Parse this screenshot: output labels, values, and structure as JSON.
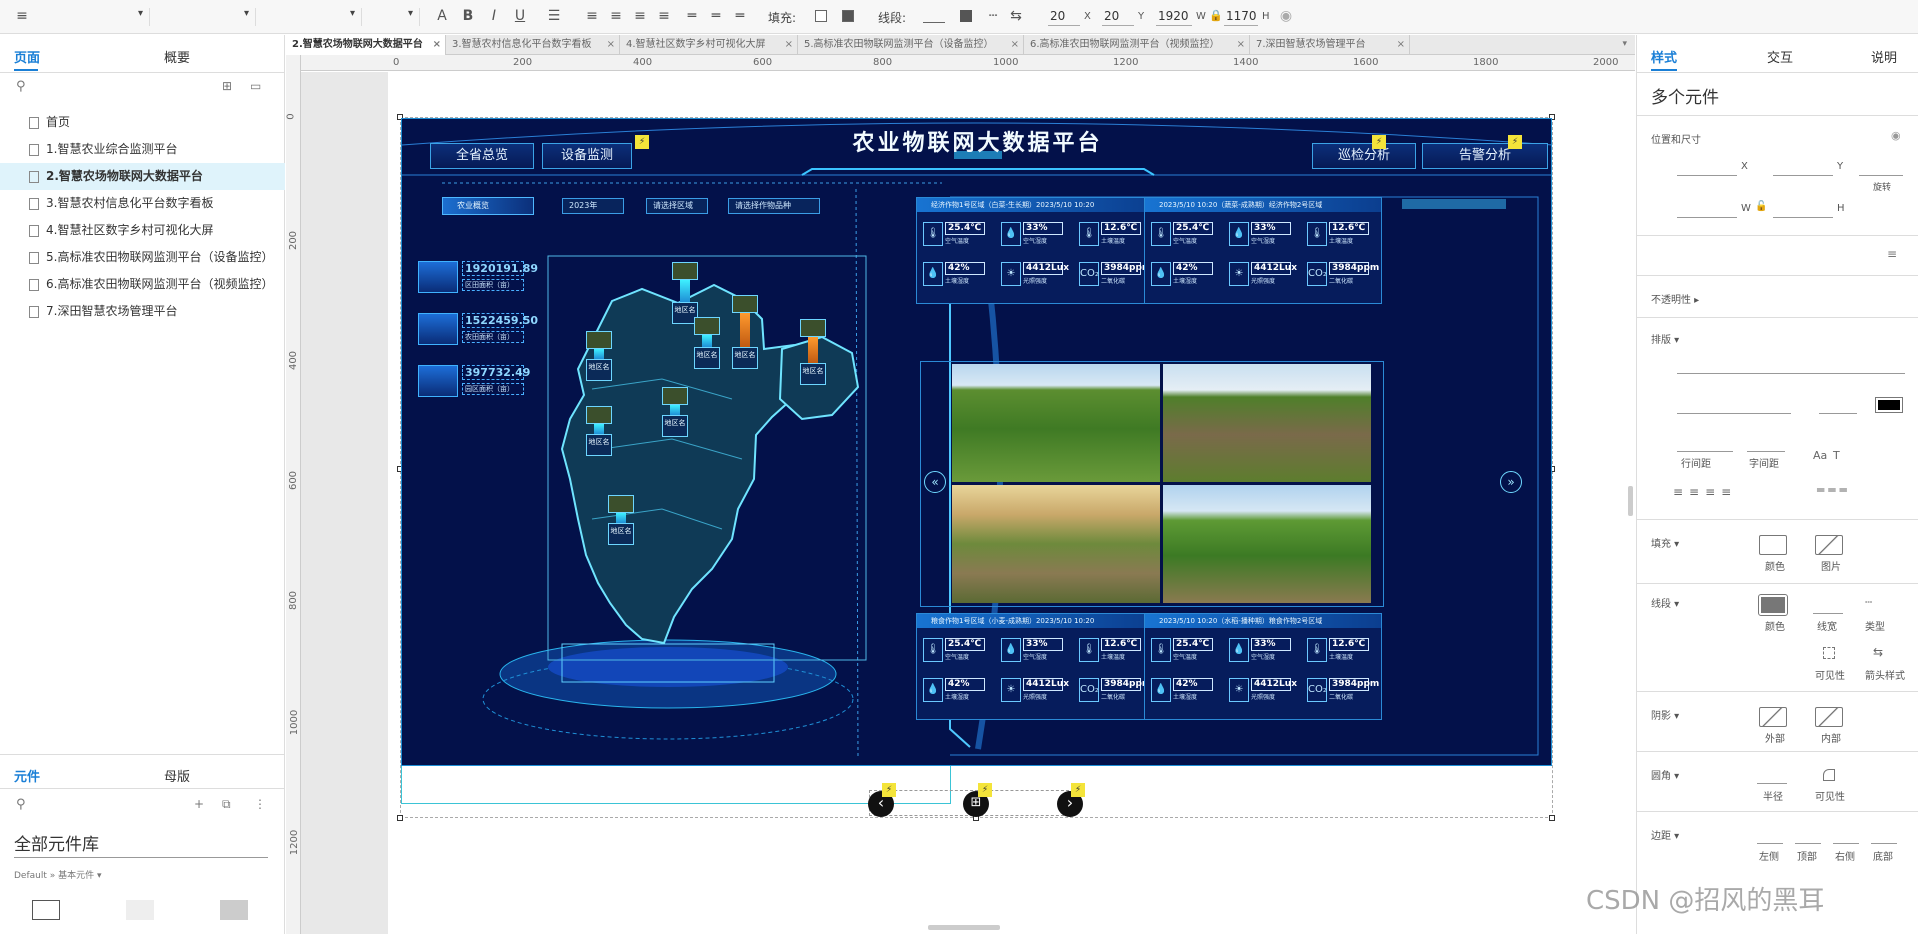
{
  "toolbar": {
    "fill_label": "填充:",
    "stroke_label": "线段:",
    "x": "20",
    "x_unit": "X",
    "y": "20",
    "y_unit": "Y",
    "w": "1920",
    "w_unit": "W",
    "h": "1170",
    "h_unit": "H"
  },
  "left": {
    "tab_pages": "页面",
    "tab_outline": "概要",
    "pages": [
      "首页",
      "1.智慧农业综合监测平台",
      "2.智慧农场物联网大数据平台",
      "3.智慧农村信息化平台数字看板",
      "4.智慧社区数字乡村可视化大屏",
      "5.高标准农田物联网监测平台（设备监控）",
      "6.高标准农田物联网监测平台（视频监控）",
      "7.深田智慧农场管理平台"
    ],
    "tab_widgets": "元件",
    "tab_masters": "母版",
    "library": "全部元件库",
    "library_sub": "Default » 基本元件 ▾"
  },
  "tabs": [
    "2.智慧农场物联网大数据平台",
    "3.智慧农村信息化平台数字看板",
    "4.智慧社区数字乡村可视化大屏",
    "5.高标准农田物联网监测平台（设备监控）",
    "6.高标准农田物联网监测平台（视频监控）",
    "7.深田智慧农场管理平台"
  ],
  "ruler_h": [
    "0",
    "200",
    "400",
    "600",
    "800",
    "1000",
    "1200",
    "1400",
    "1600",
    "1800",
    "2000"
  ],
  "ruler_v": [
    "0",
    "200",
    "400",
    "600",
    "800",
    "1000",
    "1200"
  ],
  "dashboard": {
    "title": "农业物联网大数据平台",
    "nav": [
      "全省总览",
      "设备监测",
      "巡检分析",
      "告警分析"
    ],
    "section_label": "农业概览",
    "selects": [
      "2023年",
      "请选择区域",
      "请选择作物品种"
    ],
    "stats": [
      {
        "value": "1920191.89",
        "label": "区田面积（亩）"
      },
      {
        "value": "1522459.50",
        "label": "农田面积（亩）"
      },
      {
        "value": "397732.49",
        "label": "园区面积（亩）"
      }
    ],
    "region_label": "地区名",
    "panels": [
      {
        "title": "经济作物1号区域（白菜-生长期）2023/5/10 10:20"
      },
      {
        "title": "2023/5/10 10:20（蔬菜-成熟期）经济作物2号区域"
      },
      {
        "title": "粮食作物1号区域（小麦-成熟期）2023/5/10 10:20"
      },
      {
        "title": "2023/5/10 10:20（水稻-播种期）粮食作物2号区域"
      }
    ],
    "metrics": [
      {
        "value": "25.4℃",
        "name": "空气温度"
      },
      {
        "value": "33%",
        "name": "空气湿度"
      },
      {
        "value": "12.6℃",
        "name": "土壤温度"
      },
      {
        "value": "42%",
        "name": "土壤湿度"
      },
      {
        "value": "4412Lux",
        "name": "光照强度"
      },
      {
        "value": "3984ppm",
        "name": "二氧化碳"
      }
    ],
    "co2": "CO₂"
  },
  "right": {
    "tab_style": "样式",
    "tab_interact": "交互",
    "tab_notes": "说明",
    "heading": "多个元件",
    "pos_size": "位置和尺寸",
    "x": "X",
    "y": "Y",
    "w": "W",
    "h": "H",
    "rotate": "旋转",
    "opacity": "不透明性 ▸",
    "typography": "排版 ▾",
    "line_spacing": "行间距",
    "char_spacing": "字间距",
    "fill": "填充 ▾",
    "fill_color": "颜色",
    "fill_image": "图片",
    "stroke": "线段 ▾",
    "stroke_color": "颜色",
    "stroke_width": "线宽",
    "stroke_type": "类型",
    "visibility": "可见性",
    "arrow_style": "箭头样式",
    "shadow": "阴影 ▾",
    "outer": "外部",
    "inner": "内部",
    "corner": "圆角 ▾",
    "radius": "半径",
    "visibility2": "可见性",
    "padding": "边距 ▾",
    "left": "左侧",
    "top": "顶部",
    "rightp": "右侧",
    "bottom": "底部"
  },
  "watermark": "CSDN @招风的黑耳",
  "colors": {
    "accent": "#1a7fd6",
    "dash_bg": "#03114a",
    "dash_border": "#1e8fd6"
  }
}
